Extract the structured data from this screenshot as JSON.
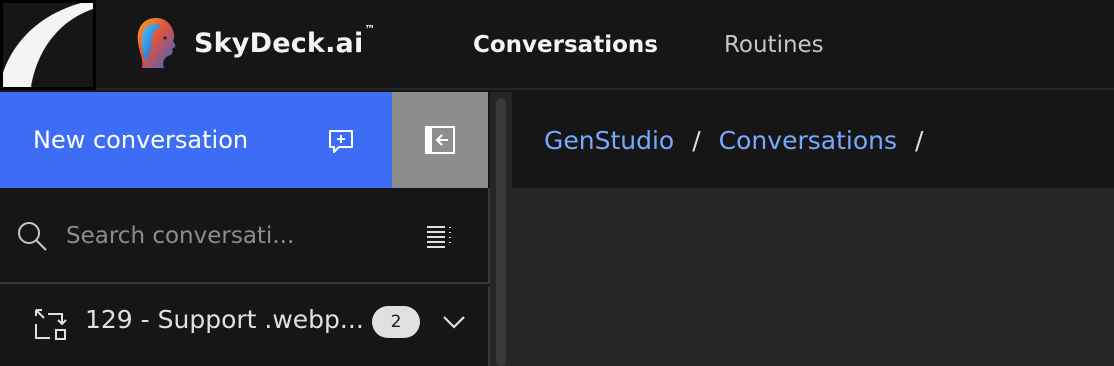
{
  "header": {
    "brand_name": "SkyDeck.ai",
    "brand_tm": "™",
    "nav": [
      {
        "label": "Conversations",
        "active": true
      },
      {
        "label": "Routines",
        "active": false
      }
    ]
  },
  "sidebar": {
    "new_conversation_label": "New conversation",
    "search": {
      "placeholder": "Search conversati...",
      "value": ""
    },
    "conversations": [
      {
        "title": "129 - Support .webp...",
        "count": "2"
      }
    ]
  },
  "main": {
    "breadcrumb": [
      {
        "label": "GenStudio"
      },
      {
        "label": "Conversations"
      }
    ],
    "breadcrumb_separator": "/"
  },
  "icons": {
    "new_conversation": "chat-add-icon",
    "collapse": "panel-collapse-icon",
    "search": "search-icon",
    "filter": "list-filter-icon",
    "conversation": "workflow-icon",
    "expand": "chevron-down-icon"
  },
  "colors": {
    "accent": "#3d6df5",
    "link": "#78a9ff",
    "background": "#161616",
    "panel": "#262626"
  }
}
